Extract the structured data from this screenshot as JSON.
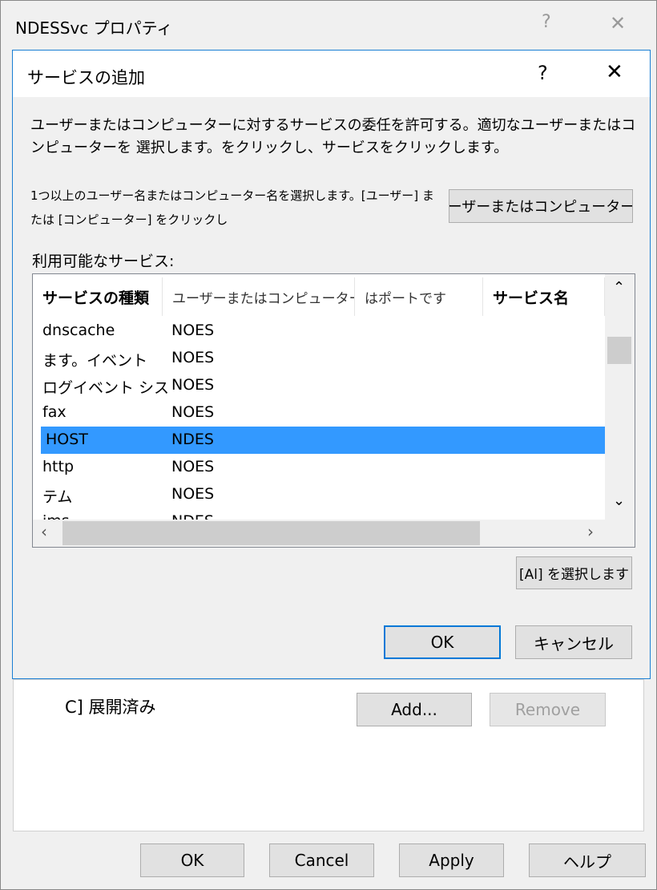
{
  "window": {
    "title": "NDESSvc プロパティ",
    "help_icon": "?",
    "close_icon": "✕"
  },
  "dialog": {
    "title": "サービスの追加",
    "help_icon": "?",
    "close_icon": "✕",
    "description": "ユーザーまたはコンピューターに対するサービスの委任を許可する。適切なユーザーまたはコンピューターを 選択します。をクリックし、サービスをクリックします。",
    "instruction": "1つ以上のユーザー名またはコンピューター名を選択します。[ユーザー] または [コンピューター] をクリックし",
    "users_button": "ユーザーまたはコンピューター...",
    "list_label": "利用可能なサービス:",
    "columns": [
      "サービスの種類",
      "ユーザーまたはコンピューター",
      "はポートです",
      "サービス名"
    ],
    "rows": [
      {
        "type": "dnscache",
        "user": "NOES"
      },
      {
        "type": "ます。イベント",
        "user": "NOES"
      },
      {
        "type": "ログイベント シス",
        "user": "NOES"
      },
      {
        "type": "fax",
        "user": "NOES"
      },
      {
        "type": "HOST",
        "user": "NDES",
        "selected": true
      },
      {
        "type": "http",
        "user": "NOES"
      },
      {
        "type": "テム",
        "user": "NOES"
      },
      {
        "type": "ims",
        "user": "NDES"
      }
    ],
    "select_all_button": "[Al] を選択します",
    "ok_button": "OK",
    "cancel_button": "キャンセル",
    "selection_color": "#3399ff"
  },
  "background": {
    "expanded_label": "C] 展開済み",
    "add_button": "Add...",
    "remove_button": "Remove"
  },
  "footer": {
    "ok": "OK",
    "cancel": "Cancel",
    "apply": "Apply",
    "help": "ヘルプ"
  }
}
